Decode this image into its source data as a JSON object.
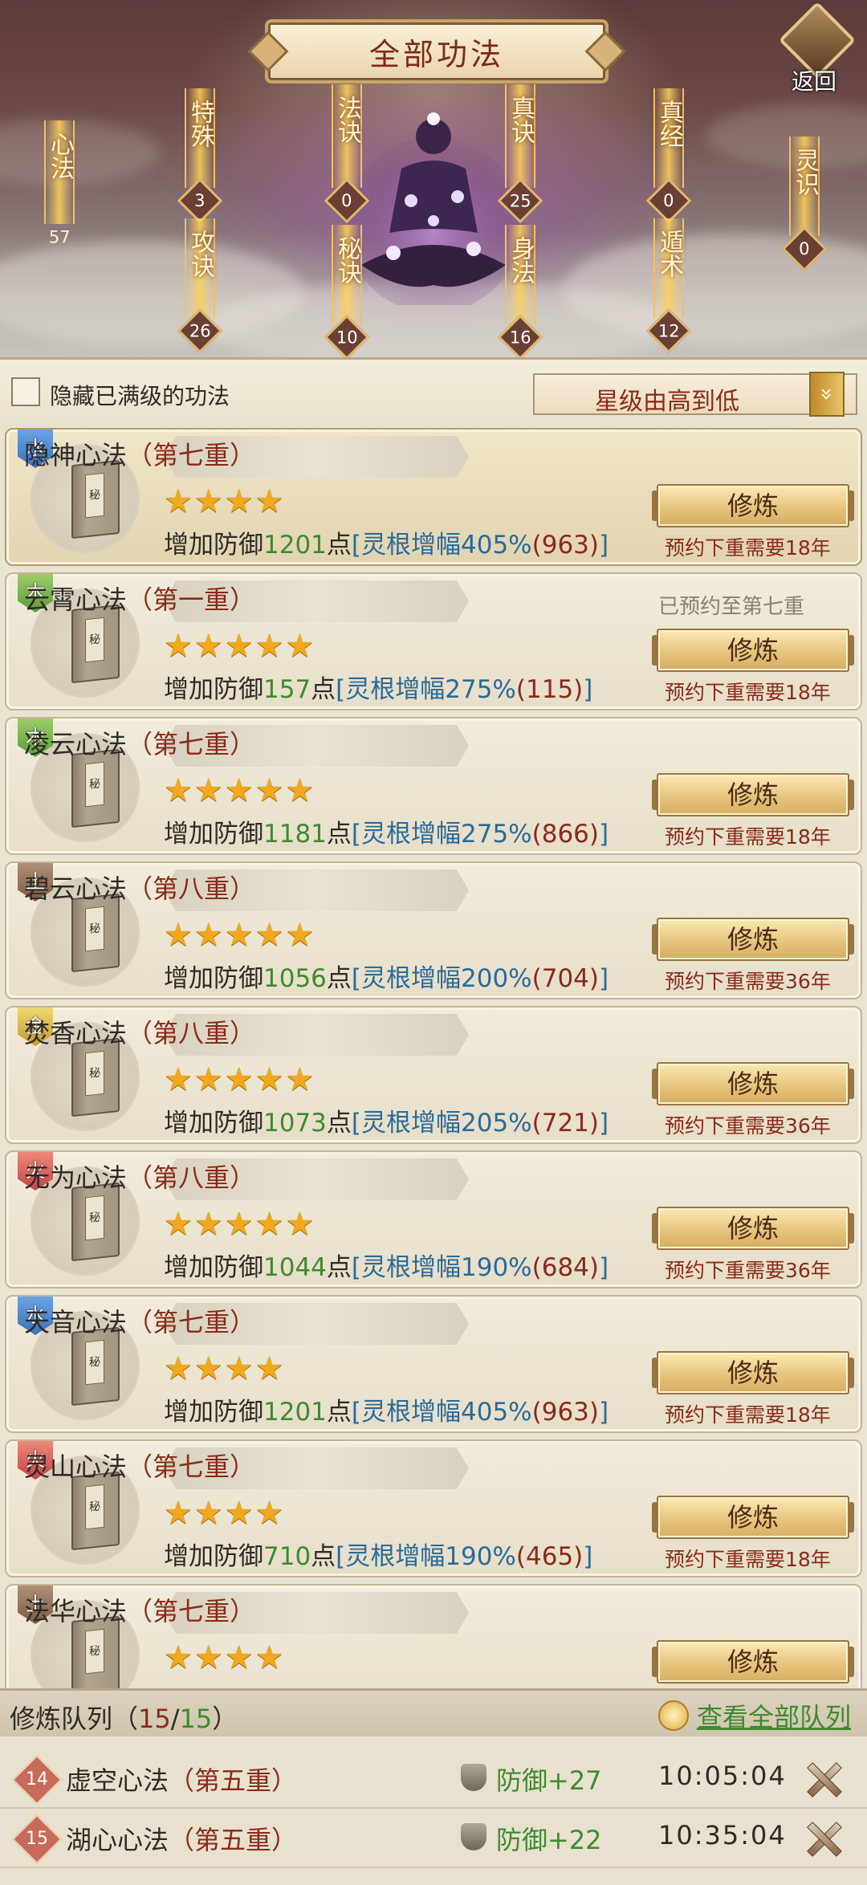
{
  "header": {
    "title": "全部功法",
    "back_label": "返回",
    "categories": [
      {
        "name": "心法",
        "count": "57"
      },
      {
        "name": "特殊",
        "count": "3"
      },
      {
        "name": "攻诀",
        "count": "26"
      },
      {
        "name": "法诀",
        "count": "0"
      },
      {
        "name": "秘诀",
        "count": "10"
      },
      {
        "name": "真诀",
        "count": "25"
      },
      {
        "name": "身法",
        "count": "16"
      },
      {
        "name": "真经",
        "count": "0"
      },
      {
        "name": "遁术",
        "count": "12"
      },
      {
        "name": "灵识",
        "count": "0"
      }
    ]
  },
  "filter": {
    "hide_maxed_label": "隐藏已满级的功法",
    "sort_label": "星级由高到低",
    "sort_arrow": "»"
  },
  "cards": [
    {
      "element": "水",
      "element_color": "#4a84cf",
      "name": "隐神心法",
      "level": "（第七重）",
      "stars": 4,
      "desc_prefix": "增加防御",
      "value": "1201",
      "unit": "点",
      "amp_open": "[灵根增幅405%",
      "amp_extra": "(963)",
      "amp_close": "]",
      "reserved_note": "",
      "button": "修炼",
      "need": "预约下重需要18年",
      "selected": true
    },
    {
      "element": "木",
      "element_color": "#6aa24a",
      "name": "云霄心法",
      "level": "（第一重）",
      "stars": 5,
      "desc_prefix": "增加防御",
      "value": "157",
      "unit": "点",
      "amp_open": "[灵根增幅275%",
      "amp_extra": "(115)",
      "amp_close": "]",
      "reserved_note": "已预约至第七重",
      "button": "修炼",
      "need": "预约下重需要18年",
      "selected": false
    },
    {
      "element": "木",
      "element_color": "#6aa24a",
      "name": "凌云心法",
      "level": "（第七重）",
      "stars": 5,
      "desc_prefix": "增加防御",
      "value": "1181",
      "unit": "点",
      "amp_open": "[灵根增幅275%",
      "amp_extra": "(866)",
      "amp_close": "]",
      "reserved_note": "",
      "button": "修炼",
      "need": "预约下重需要18年",
      "selected": false
    },
    {
      "element": "土",
      "element_color": "#8a6a54",
      "name": "碧云心法",
      "level": "（第八重）",
      "stars": 5,
      "desc_prefix": "增加防御",
      "value": "1056",
      "unit": "点",
      "amp_open": "[灵根增幅200%",
      "amp_extra": "(704)",
      "amp_close": "]",
      "reserved_note": "",
      "button": "修炼",
      "need": "预约下重需要36年",
      "selected": false
    },
    {
      "element": "金",
      "element_color": "#d2b040",
      "name": "焚香心法",
      "level": "（第八重）",
      "stars": 5,
      "desc_prefix": "增加防御",
      "value": "1073",
      "unit": "点",
      "amp_open": "[灵根增幅205%",
      "amp_extra": "(721)",
      "amp_close": "]",
      "reserved_note": "",
      "button": "修炼",
      "need": "预约下重需要36年",
      "selected": false
    },
    {
      "element": "火",
      "element_color": "#d45a56",
      "name": "无为心法",
      "level": "（第八重）",
      "stars": 5,
      "desc_prefix": "增加防御",
      "value": "1044",
      "unit": "点",
      "amp_open": "[灵根增幅190%",
      "amp_extra": "(684)",
      "amp_close": "]",
      "reserved_note": "",
      "button": "修炼",
      "need": "预约下重需要36年",
      "selected": false
    },
    {
      "element": "水",
      "element_color": "#4a84cf",
      "name": "天音心法",
      "level": "（第七重）",
      "stars": 4,
      "desc_prefix": "增加防御",
      "value": "1201",
      "unit": "点",
      "amp_open": "[灵根增幅405%",
      "amp_extra": "(963)",
      "amp_close": "]",
      "reserved_note": "",
      "button": "修炼",
      "need": "预约下重需要18年",
      "selected": false
    },
    {
      "element": "火",
      "element_color": "#d45a56",
      "name": "灵山心法",
      "level": "（第七重）",
      "stars": 4,
      "desc_prefix": "增加防御",
      "value": "710",
      "unit": "点",
      "amp_open": "[灵根增幅190%",
      "amp_extra": "(465)",
      "amp_close": "]",
      "reserved_note": "",
      "button": "修炼",
      "need": "预约下重需要18年",
      "selected": false
    },
    {
      "element": "土",
      "element_color": "#8a6a54",
      "name": "法华心法",
      "level": "（第七重）",
      "stars": 4,
      "desc_prefix": "",
      "value": "",
      "unit": "",
      "amp_open": "",
      "amp_extra": "",
      "amp_close": "",
      "reserved_note": "",
      "button": "修炼",
      "need": "",
      "selected": false
    }
  ],
  "queue": {
    "title": "修炼队列",
    "count_open": "（",
    "count_current": "15",
    "count_sep": "/",
    "count_total": "15",
    "count_close": "）",
    "view_all_label": "查看全部队列",
    "items": [
      {
        "index": "14",
        "name": "虚空心法",
        "level": "（第五重）",
        "bonus": "防御+27",
        "time": "10:05:04"
      },
      {
        "index": "15",
        "name": "湖心心法",
        "level": "（第五重）",
        "bonus": "防御+22",
        "time": "10:35:04"
      }
    ]
  }
}
